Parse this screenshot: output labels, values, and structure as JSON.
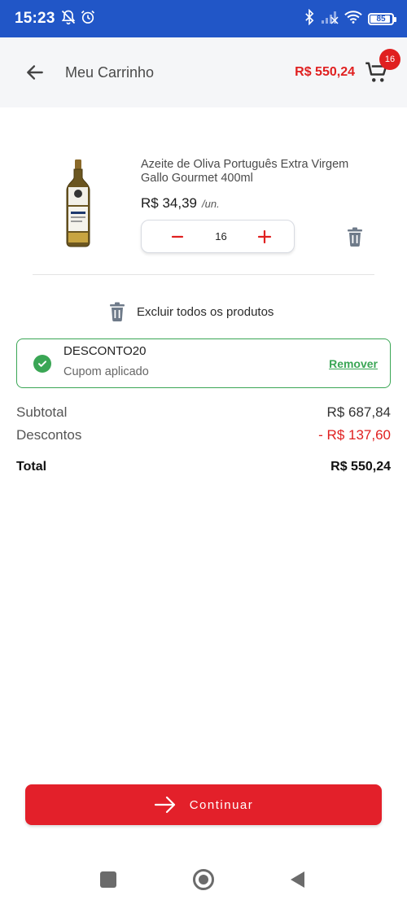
{
  "status_bar": {
    "time": "15:23",
    "battery": "85",
    "icons": [
      "bell-off-icon",
      "alarm-icon",
      "bluetooth-icon",
      "signal-icon",
      "wifi-icon",
      "battery-icon"
    ]
  },
  "header": {
    "title": "Meu Carrinho",
    "cart_total": "R$ 550,24",
    "cart_count": "16"
  },
  "product": {
    "name": "Azeite de Oliva Português Extra Virgem Gallo Gourmet 400ml",
    "price": "R$ 34,39",
    "unit": "/un.",
    "quantity": "16"
  },
  "delete_all_label": "Excluir todos os produtos",
  "coupon": {
    "code": "DESCONTO20",
    "status": "Cupom aplicado",
    "remove_label": "Remover"
  },
  "summary": {
    "subtotal_label": "Subtotal",
    "subtotal_value": "R$ 687,84",
    "discount_label": "Descontos",
    "discount_value": "- R$ 137,60",
    "total_label": "Total",
    "total_value": "R$ 550,24"
  },
  "continue_label": "Continuar",
  "colors": {
    "status_bar": "#2156c7",
    "accent_red": "#e3202a",
    "success_green": "#3aa655"
  }
}
